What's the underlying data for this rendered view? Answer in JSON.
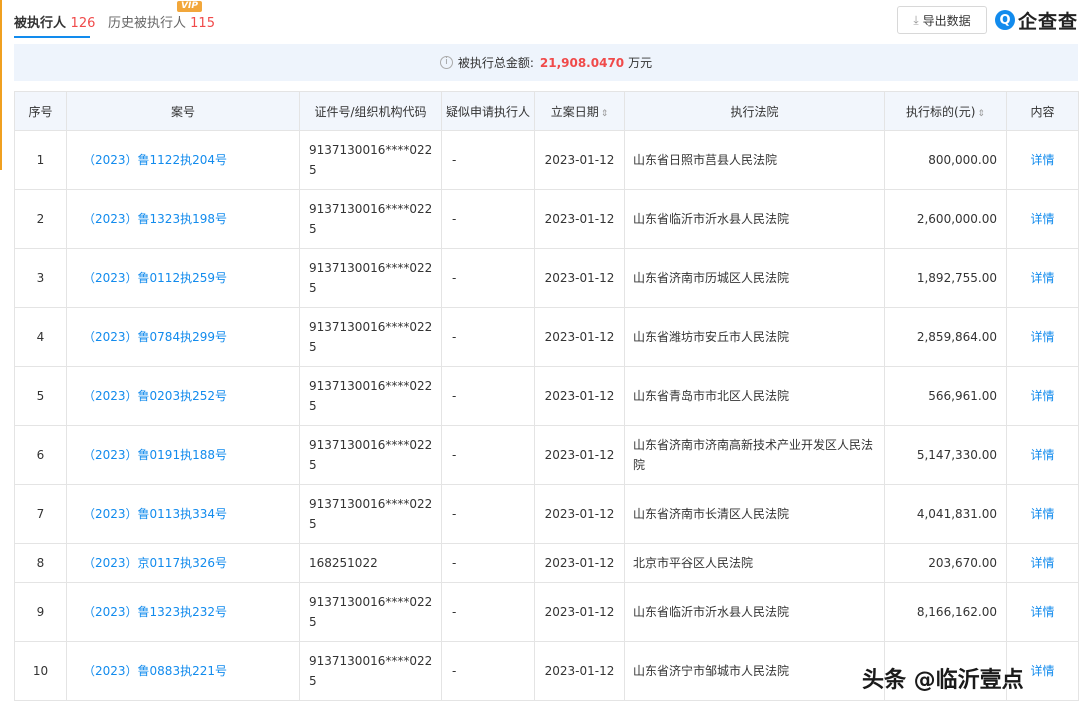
{
  "tabs": [
    {
      "label": "被执行人",
      "count": "126"
    },
    {
      "label": "历史被执行人",
      "count": "115",
      "badge": "VIP"
    }
  ],
  "toolbar": {
    "export_label": "导出数据",
    "export_icon": "download-icon"
  },
  "logo": {
    "mark": "Q",
    "text": "企查查"
  },
  "summary": {
    "label": "被执行总金额:",
    "amount": "21,908.0470",
    "unit": "万元",
    "icon": "info-icon"
  },
  "table": {
    "headers": [
      "序号",
      "案号",
      "证件号/组织机构代码",
      "疑似申请执行人",
      "立案日期",
      "执行法院",
      "执行标的(元)",
      "内容"
    ],
    "sort_icon": "⇕",
    "rows": [
      {
        "idx": "1",
        "case": "（2023）鲁1122执204号",
        "code": "9137130016****0225",
        "suspect": "-",
        "date": "2023-01-12",
        "court": "山东省日照市莒县人民法院",
        "amount": "800,000.00",
        "action": "详情"
      },
      {
        "idx": "2",
        "case": "（2023）鲁1323执198号",
        "code": "9137130016****0225",
        "suspect": "-",
        "date": "2023-01-12",
        "court": "山东省临沂市沂水县人民法院",
        "amount": "2,600,000.00",
        "action": "详情"
      },
      {
        "idx": "3",
        "case": "（2023）鲁0112执259号",
        "code": "9137130016****0225",
        "suspect": "-",
        "date": "2023-01-12",
        "court": "山东省济南市历城区人民法院",
        "amount": "1,892,755.00",
        "action": "详情"
      },
      {
        "idx": "4",
        "case": "（2023）鲁0784执299号",
        "code": "9137130016****0225",
        "suspect": "-",
        "date": "2023-01-12",
        "court": "山东省潍坊市安丘市人民法院",
        "amount": "2,859,864.00",
        "action": "详情"
      },
      {
        "idx": "5",
        "case": "（2023）鲁0203执252号",
        "code": "9137130016****0225",
        "suspect": "-",
        "date": "2023-01-12",
        "court": "山东省青岛市市北区人民法院",
        "amount": "566,961.00",
        "action": "详情"
      },
      {
        "idx": "6",
        "case": "（2023）鲁0191执188号",
        "code": "9137130016****0225",
        "suspect": "-",
        "date": "2023-01-12",
        "court": "山东省济南市济南高新技术产业开发区人民法院",
        "amount": "5,147,330.00",
        "action": "详情"
      },
      {
        "idx": "7",
        "case": "（2023）鲁0113执334号",
        "code": "9137130016****0225",
        "suspect": "-",
        "date": "2023-01-12",
        "court": "山东省济南市长清区人民法院",
        "amount": "4,041,831.00",
        "action": "详情"
      },
      {
        "idx": "8",
        "case": "（2023）京0117执326号",
        "code": "168251022",
        "suspect": "-",
        "date": "2023-01-12",
        "court": "北京市平谷区人民法院",
        "amount": "203,670.00",
        "action": "详情"
      },
      {
        "idx": "9",
        "case": "（2023）鲁1323执232号",
        "code": "9137130016****0225",
        "suspect": "-",
        "date": "2023-01-12",
        "court": "山东省临沂市沂水县人民法院",
        "amount": "8,166,162.00",
        "action": "详情"
      },
      {
        "idx": "10",
        "case": "（2023）鲁0883执221号",
        "code": "9137130016****0225",
        "suspect": "-",
        "date": "2023-01-12",
        "court": "山东省济宁市邹城市人民法院",
        "amount": "",
        "action": "详情"
      }
    ]
  },
  "watermark": "头条 @临沂壹点",
  "colors": {
    "accent": "#128bed",
    "count_red": "#f04a4a",
    "vip": "#f2a73b",
    "summary_bg": "#eef4fc",
    "header_bg": "#f2f6fc"
  }
}
